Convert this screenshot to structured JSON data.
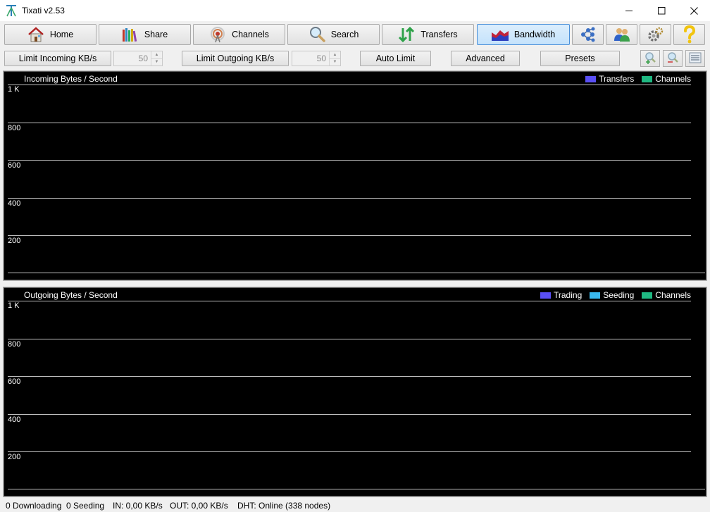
{
  "window": {
    "title": "Tixati v2.53"
  },
  "toolbar": {
    "home_label": "Home",
    "share_label": "Share",
    "channels_label": "Channels",
    "search_label": "Search",
    "transfers_label": "Transfers",
    "bandwidth_label": "Bandwidth",
    "active_tab": "Bandwidth",
    "extra_icons": [
      "network-icon",
      "users-icon",
      "settings-icon",
      "help-icon"
    ]
  },
  "controls": {
    "limit_incoming_label": "Limit Incoming KB/s",
    "limit_incoming_value": "50",
    "limit_outgoing_label": "Limit Outgoing KB/s",
    "limit_outgoing_value": "50",
    "auto_limit_label": "Auto Limit",
    "advanced_label": "Advanced",
    "presets_label": "Presets",
    "right_icons": [
      "zoom-in-icon",
      "zoom-out-icon",
      "list-icon"
    ]
  },
  "incoming_graph": {
    "title": "Incoming Bytes / Second",
    "legend": [
      {
        "name": "Transfers",
        "color": "#5a4ff5"
      },
      {
        "name": "Channels",
        "color": "#1fb882"
      }
    ],
    "y_ticks": [
      "1 K",
      "800",
      "600",
      "400",
      "200"
    ]
  },
  "outgoing_graph": {
    "title": "Outgoing Bytes / Second",
    "legend": [
      {
        "name": "Trading",
        "color": "#5a4ff5"
      },
      {
        "name": "Seeding",
        "color": "#39b8ee"
      },
      {
        "name": "Channels",
        "color": "#1fb882"
      }
    ],
    "y_ticks": [
      "1 K",
      "800",
      "600",
      "400",
      "200"
    ]
  },
  "status": {
    "downloading": "0 Downloading",
    "seeding": "0 Seeding",
    "in_rate": "IN: 0,00 KB/s",
    "out_rate": "OUT: 0,00 KB/s",
    "dht": "DHT: Online (338 nodes)"
  }
}
